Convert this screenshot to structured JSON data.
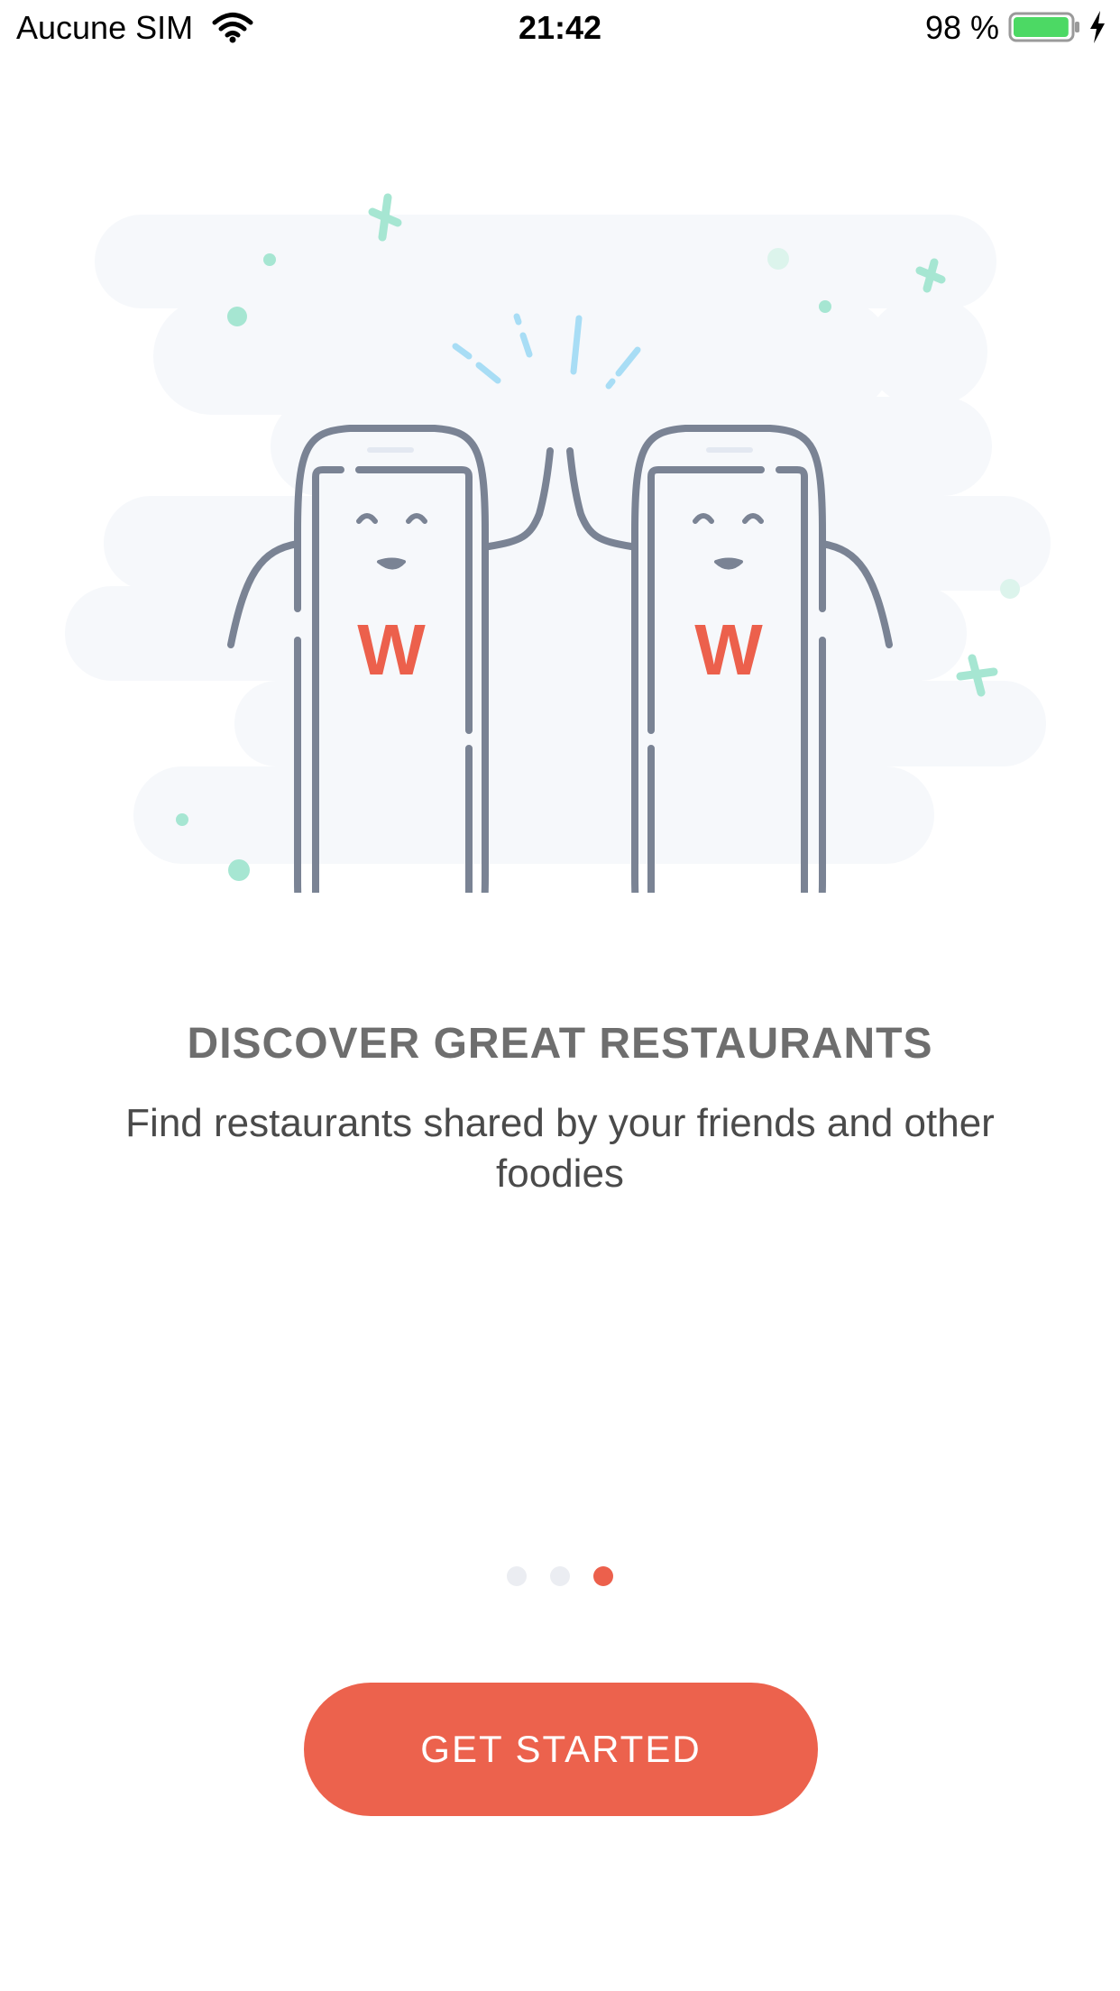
{
  "status_bar": {
    "carrier": "Aucune SIM",
    "time": "21:42",
    "battery_percent": "98 %",
    "battery_level": 0.98,
    "icons": [
      "wifi-icon",
      "battery-icon",
      "charging-bolt-icon"
    ]
  },
  "illustration": {
    "subject": "two-phones-high-five",
    "logo_letter": "W",
    "colors": {
      "phone_stroke": "#7a8394",
      "logo": "#ec604c",
      "sparkle": "#a8ddf5",
      "confetti": "#a6e6d2",
      "cloud": "#f6f8fb"
    }
  },
  "onboarding": {
    "headline": "DISCOVER GREAT RESTAURANTS",
    "subtitle": "Find restaurants shared by your friends and other foodies"
  },
  "pager": {
    "count": 3,
    "active_index": 2,
    "colors": {
      "inactive": "#ebedf2",
      "active": "#ec604c"
    }
  },
  "cta": {
    "label": "GET STARTED",
    "color": "#ec624d"
  }
}
